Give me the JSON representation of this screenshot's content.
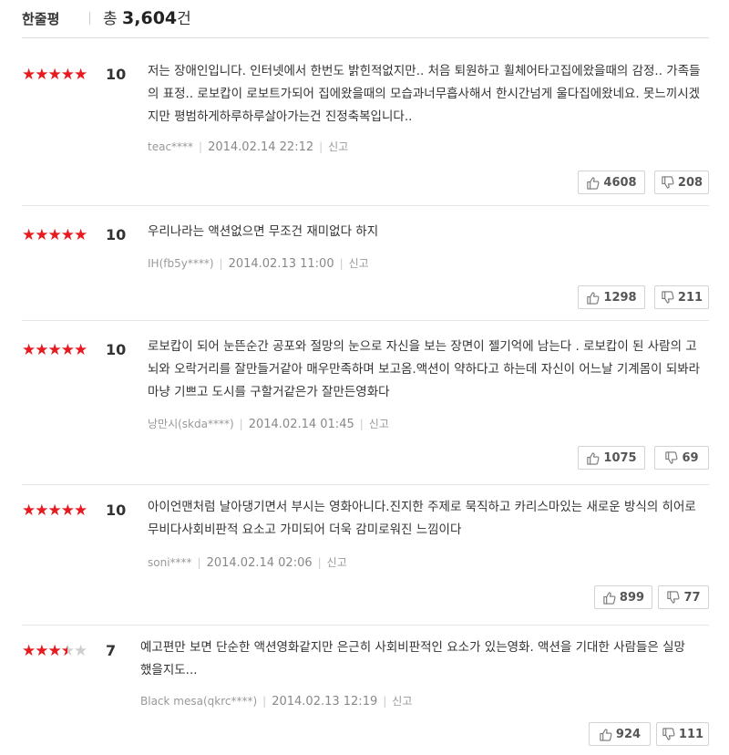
{
  "header": {
    "title": "한줄평",
    "total_prefix": "총 ",
    "total_count": "3,604",
    "total_suffix": "건"
  },
  "colors": {
    "star_on": "#e8191f",
    "star_off": "#cfcfcf"
  },
  "reviews": [
    {
      "stars": 5,
      "score": "10",
      "text": "저는 장애인입니다. 인터넷에서 한번도 밝힌적없지만.. 처음 퇴원하고 휠체어타고집에왔을때의 감정.. 가족들의 표정.. 로보캅이 로보트가되어 집에왔을때의 모습과너무흡사해서 한시간넘게 울다집에왔네요. 못느끼시겠지만 평범하게하루하루살아가는건 진정축복입니다..",
      "user": "teac****",
      "date": "2014.02.14 22:12",
      "report": "신고",
      "likes": "4608",
      "dislikes": "208"
    },
    {
      "stars": 5,
      "score": "10",
      "text": "우리나라는 액션없으면 무조건 재미없다 하지",
      "user": "IH(fb5y****)",
      "date": "2014.02.13 11:00",
      "report": "신고",
      "likes": "1298",
      "dislikes": "211"
    },
    {
      "stars": 5,
      "score": "10",
      "text": "로보캅이 되어 눈뜬순간 공포와 절망의 눈으로 자신을 보는 장면이 젤기억에 남는다 . 로보캅이 된 사람의 고뇌와 오락거리를 잘만들거같아 매우만족하며 보고옴.액션이 약하다고 하는데 자신이 어느날 기계몸이 되봐라 마냥 기쁘고 도시를 구할거같은가 잘만든영화다",
      "user": "낭만시(skda****)",
      "date": "2014.02.14 01:45",
      "report": "신고",
      "likes": "1075",
      "dislikes": "69"
    },
    {
      "stars": 5,
      "score": "10",
      "text": "아이언맨처럼 날아댕기면서 부시는 영화아니다.진지한 주제로 묵직하고 카리스마있는 새로운 방식의 히어로무비다사회비판적 요소고 가미되어 더욱 감미로워진 느낌이다",
      "user": "soni****",
      "date": "2014.02.14 02:06",
      "report": "신고",
      "likes": "899",
      "dislikes": "77"
    },
    {
      "stars": 3.5,
      "score": "7",
      "text": "예고편만 보면 단순한 액션영화같지만 은근히 사회비판적인 요소가 있는영화. 액션을 기대한 사람들은 실망했을지도...",
      "user": "Black mesa(qkrc****)",
      "date": "2014.02.13 12:19",
      "report": "신고",
      "likes": "924",
      "dislikes": "111"
    }
  ]
}
